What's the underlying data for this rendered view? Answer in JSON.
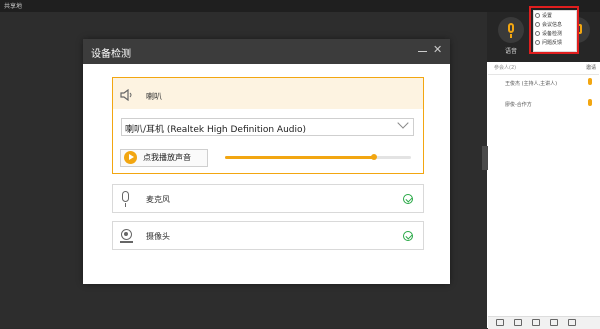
{
  "app": {
    "title": "共享地"
  },
  "right_panel": {
    "mic_label": "语音",
    "participants_label": "参会人(2)",
    "invite_label": "邀请",
    "participants": [
      {
        "name": "王俊杰 (主持人,主讲人)"
      },
      {
        "name": "廖俊-合作方"
      }
    ],
    "menu": {
      "items": [
        {
          "label": "设置"
        },
        {
          "label": "会议信息"
        },
        {
          "label": "设备检测"
        },
        {
          "label": "问题反馈"
        }
      ]
    }
  },
  "dialog": {
    "title": "设备检测",
    "speaker": {
      "label": "喇叭",
      "selected_device": "喇叭/耳机 (Realtek High Definition Audio)",
      "play_label": "点我播放声音",
      "volume_fraction": 0.8
    },
    "microphone": {
      "label": "麦克风",
      "status": "ok"
    },
    "camera": {
      "label": "摄像头",
      "status": "ok"
    }
  },
  "colors": {
    "accent": "#f2a611",
    "ok_green": "#27a845",
    "highlight_red": "#e01e1e"
  }
}
